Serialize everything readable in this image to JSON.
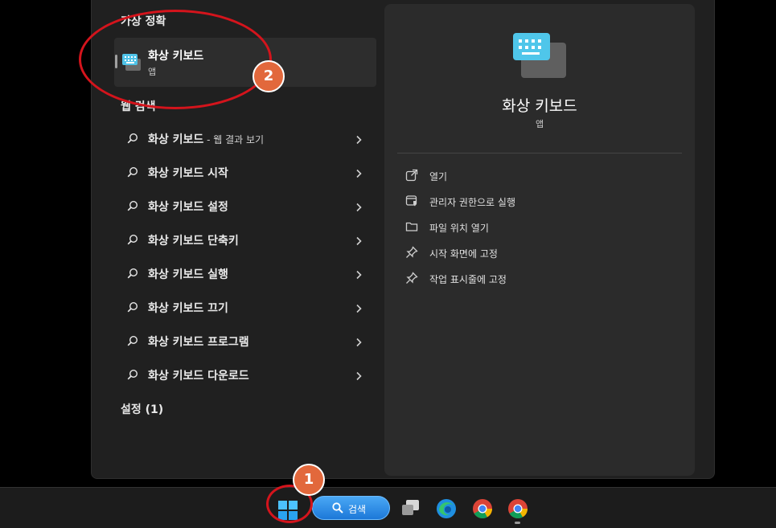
{
  "sections": {
    "best_match": "가상 정확",
    "web_search": "웹 검색",
    "settings": "설정 (1)"
  },
  "best_match": {
    "name": "화상 키보드",
    "type": "앱"
  },
  "web_results": [
    {
      "label": "화상 키보드",
      "suffix": " - 웹 결과 보기"
    },
    {
      "label": "화상 키보드 시작",
      "suffix": ""
    },
    {
      "label": "화상 키보드 설정",
      "suffix": ""
    },
    {
      "label": "화상 키보드 단축키",
      "suffix": ""
    },
    {
      "label": "화상 키보드 실행",
      "suffix": ""
    },
    {
      "label": "화상 키보드 끄기",
      "suffix": ""
    },
    {
      "label": "화상 키보드 프로그램",
      "suffix": ""
    },
    {
      "label": "화상 키보드 다운로드",
      "suffix": ""
    }
  ],
  "detail": {
    "name": "화상 키보드",
    "type": "앱",
    "actions": [
      {
        "label": "열기",
        "icon": "open-external-icon"
      },
      {
        "label": "관리자 권한으로 실행",
        "icon": "admin-shield-icon"
      },
      {
        "label": "파일 위치 열기",
        "icon": "folder-icon"
      },
      {
        "label": "시작 화면에 고정",
        "icon": "pin-icon"
      },
      {
        "label": "작업 표시줄에 고정",
        "icon": "pin-icon"
      }
    ]
  },
  "taskbar": {
    "search_label": "검색",
    "icons": [
      "windows-start-icon",
      "search-icon",
      "task-view-icon",
      "edge-icon",
      "chrome-icon",
      "chrome-icon"
    ]
  },
  "annotations": {
    "badge1": "1",
    "badge2": "2"
  },
  "colors": {
    "panel_bg": "#202020",
    "detail_bg": "#2b2b2b",
    "annotation_red": "#d4141c",
    "badge_orange": "#e2683c",
    "search_blue": "#1c78d8"
  }
}
